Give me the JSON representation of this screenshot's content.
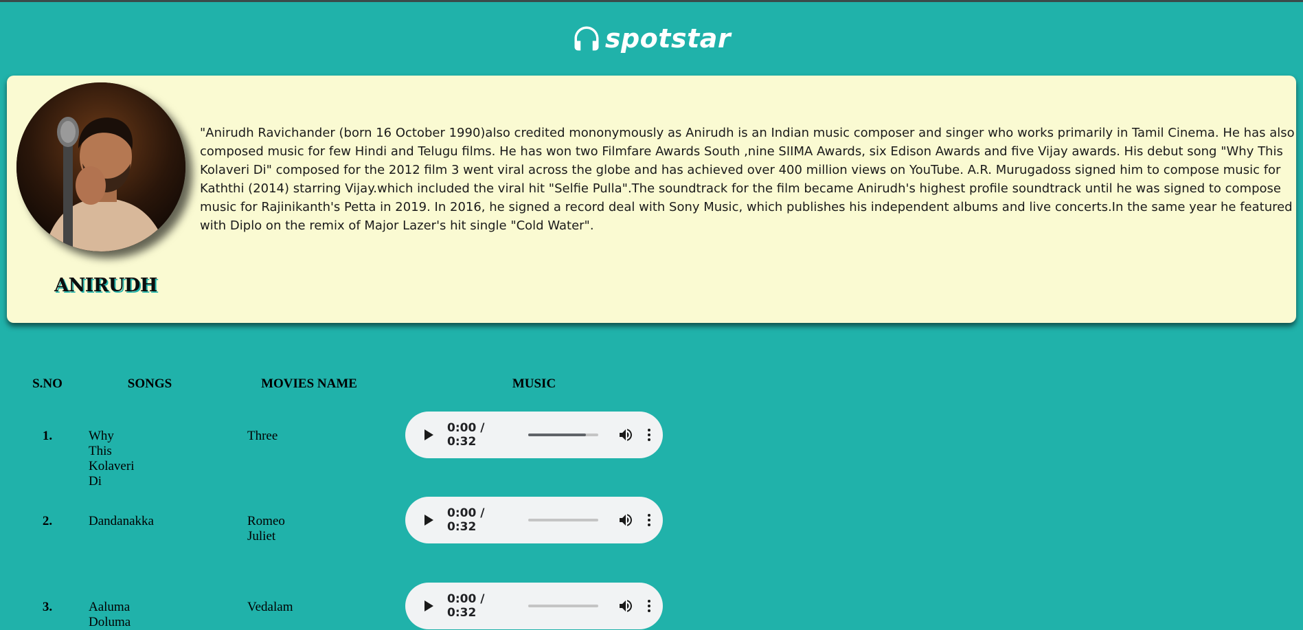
{
  "app": {
    "name": "spotstar",
    "logo_icon": "headphones-icon"
  },
  "artist": {
    "name": "ANIRUDH",
    "bio": "\"Anirudh Ravichander (born 16 October 1990)also credited mononymously as Anirudh is an Indian music composer and singer who works primarily in Tamil Cinema. He has also composed music for few Hindi and Telugu films. He has won two Filmfare Awards South ,nine SIIMA Awards, six Edison Awards and five Vijay awards. His debut song \"Why This Kolaveri Di\" composed for the 2012 film 3 went viral across the globe and has achieved over 400 million views on YouTube. A.R. Murugadoss signed him to compose music for Kaththi (2014) starring Vijay.which included the viral hit \"Selfie Pulla\".The soundtrack for the film became Anirudh's highest profile soundtrack until he was signed to compose music for Rajinikanth's Petta in 2019. In 2016, he signed a record deal with Sony Music, which publishes his independent albums and live concerts.In the same year he featured with Diplo on the remix of Major Lazer's hit single \"Cold Water\"."
  },
  "table": {
    "headers": {
      "sno": "S.NO",
      "songs": "SONGS",
      "movies": "MOVIES NAME",
      "music": "MUSIC"
    },
    "rows": [
      {
        "sno": "1.",
        "song": "Why This Kolaveri Di",
        "movie": "Three",
        "time": "0:00 / 0:32",
        "progress": 0.82
      },
      {
        "sno": "2.",
        "song": "Dandanakka",
        "movie": "Romeo Juliet",
        "time": "0:00 / 0:32",
        "progress": 0
      },
      {
        "sno": "3.",
        "song": "Aaluma Doluma",
        "movie": "Vedalam",
        "time": "0:00 / 0:32",
        "progress": 0
      }
    ]
  },
  "colors": {
    "background": "#20b2aa",
    "card": "#fafad2",
    "player": "#f1f3f4"
  }
}
